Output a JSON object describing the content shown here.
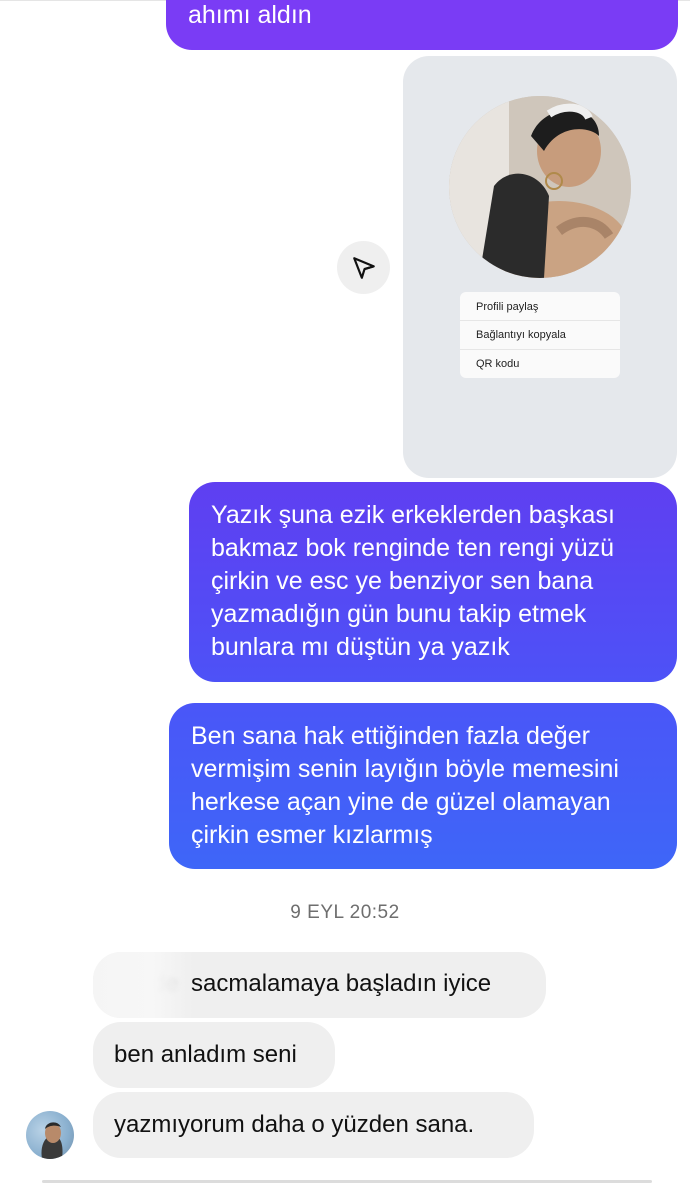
{
  "messages": {
    "outgoing_top": "ahımı aldın",
    "shared_profile": {
      "menu_items": [
        "Profili paylaş",
        "Bağlantıyı kopyala",
        "QR kodu"
      ]
    },
    "outgoing_1": "Yazık şuna ezik erkeklerden başkası bakmaz bok renginde ten rengi yüzü çirkin ve esc ye benziyor sen bana yazmadığın gün bunu takip etmek bunlara mı düştün ya yazık",
    "outgoing_2": "Ben sana hak ettiğinden fazla değer vermişim senin layığın böyle memesini herkese açan yine de güzel olamayan çirkin esmer kızlarmış",
    "timestamp": "9 EYL 20:52",
    "incoming_1": "sacmalamaya başladın iyice",
    "incoming_1_hidden": "sende",
    "incoming_2": "ben anladım seni",
    "incoming_3": "yazmıyorum daha o yüzden sana."
  },
  "icons": {
    "share": "send-icon",
    "avatar": "contact-avatar"
  },
  "colors": {
    "outgoing_purple": "#7a3cf5",
    "outgoing_blue": "#3e66f8",
    "incoming_gray": "#efefef",
    "shared_card": "#e5e8ec"
  }
}
